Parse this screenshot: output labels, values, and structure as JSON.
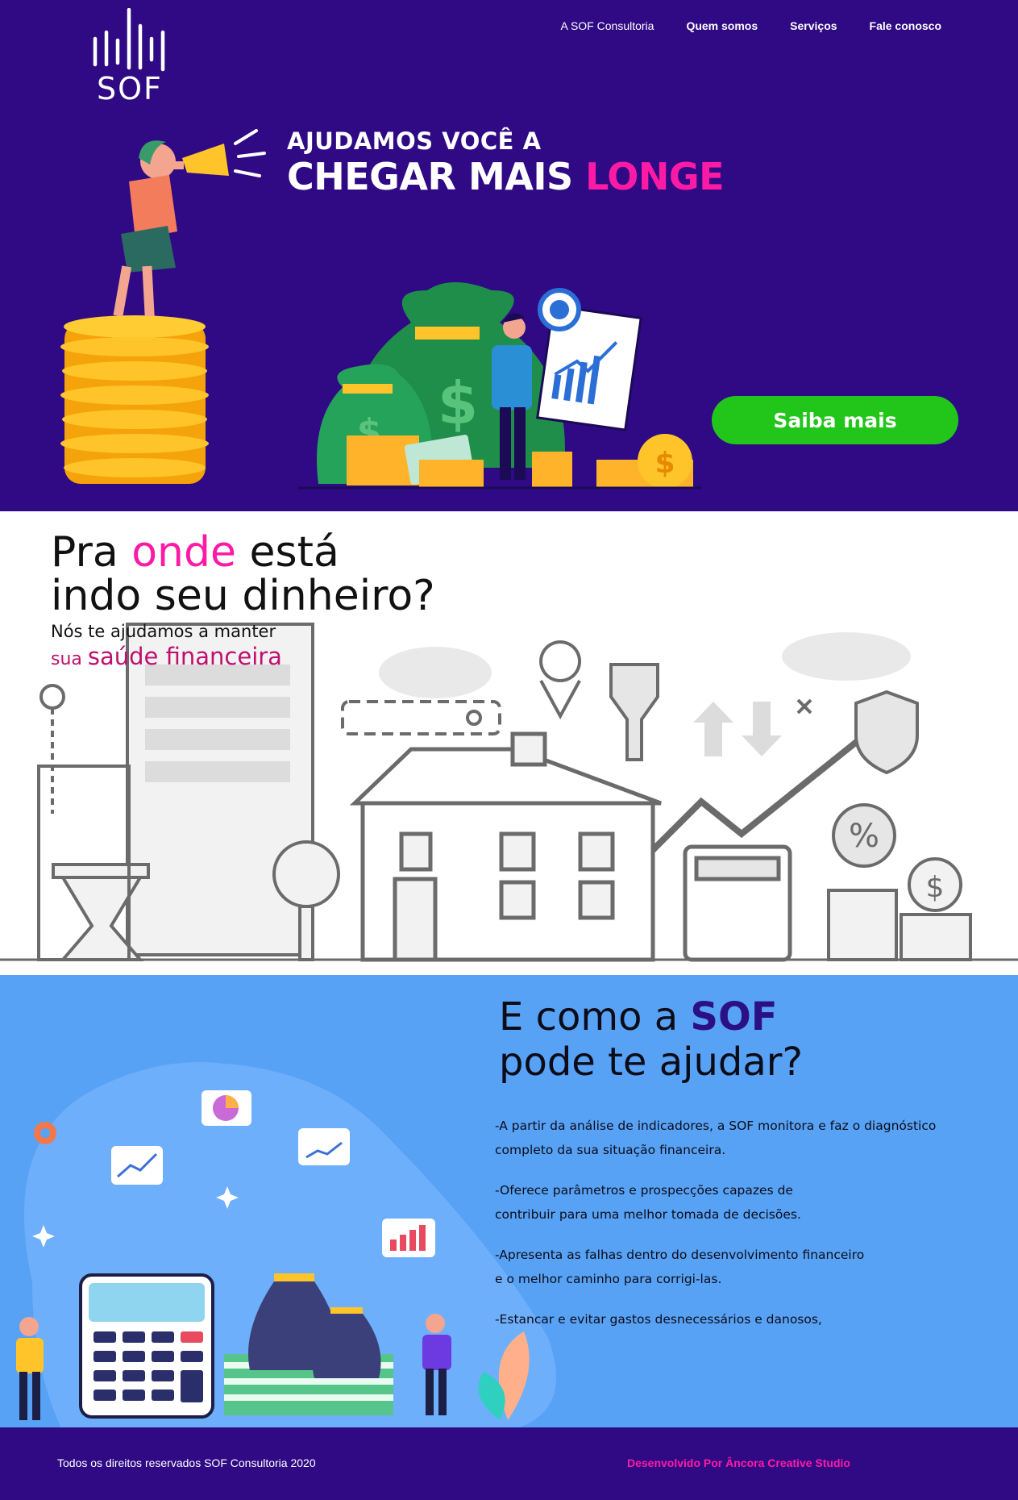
{
  "header": {
    "logo_text": "SOF",
    "nav": [
      {
        "label": "A SOF Consultoria"
      },
      {
        "label": "Quem somos"
      },
      {
        "label": "Serviços"
      },
      {
        "label": "Fale conosco"
      }
    ]
  },
  "hero": {
    "line1": "AJUDAMOS VOCÊ A",
    "line2_white": "CHEGAR MAIS ",
    "line2_pink": "LONGE",
    "cta_label": "Saiba mais"
  },
  "section_money": {
    "title_a": "Pra ",
    "title_pink": "onde",
    "title_b": " está",
    "title_line2": "indo seu dinheiro?",
    "subtitle": "Nós te ajudamos a manter",
    "subtitle2_small": "sua ",
    "subtitle2_big": "saúde financeira"
  },
  "section_help": {
    "title_a": "E como a ",
    "title_brand": "SOF",
    "title_line2": "pode te ajudar?",
    "items": [
      "-A partir da análise de indicadores, a SOF monitora e faz o diagnóstico\ncompleto da sua situação financeira.",
      "-Oferece parâmetros e prospecções capazes de\ncontribuir para uma melhor tomada de decisões.",
      "-Apresenta as falhas dentro do desenvolvimento financeiro\ne o melhor caminho para corrigi-las.",
      "-Estancar e evitar gastos desnecessários e danosos,"
    ]
  },
  "footer": {
    "copyright": "Todos os direitos reservados SOF Consultoria 2020",
    "credit": "Desenvolvido Por Âncora Creative Studio"
  },
  "colors": {
    "primary_purple": "#2f0a84",
    "accent_pink": "#ff1aa6",
    "cta_green": "#22c51a",
    "help_blue": "#58a2f6"
  }
}
